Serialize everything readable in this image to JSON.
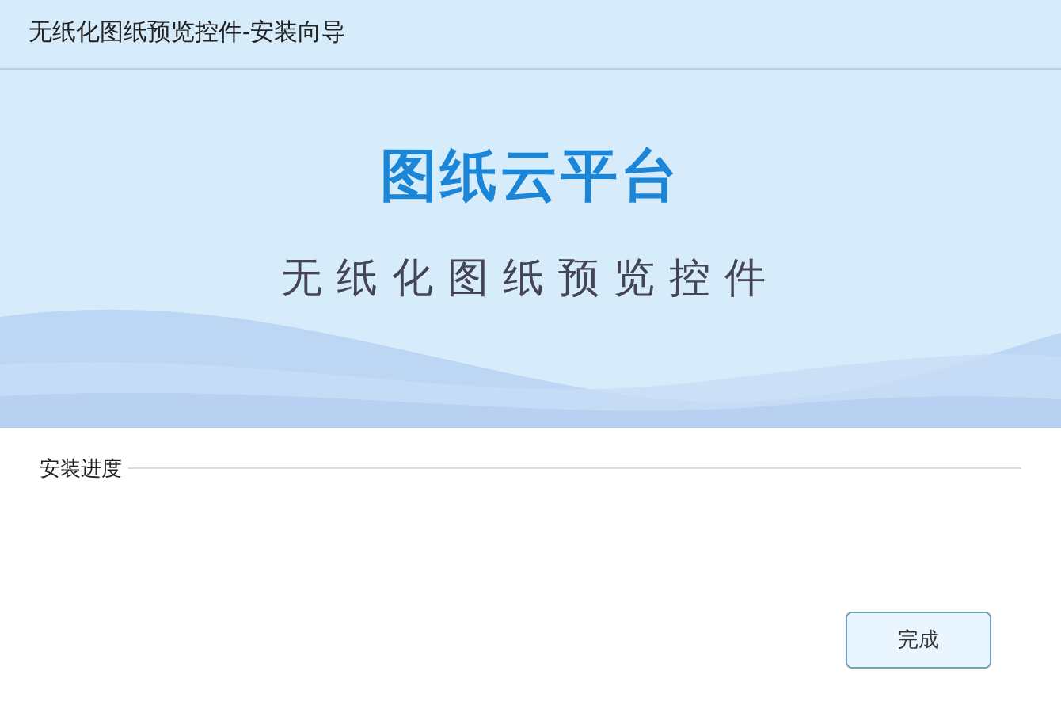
{
  "window": {
    "title": "无纸化图纸预览控件-安装向导"
  },
  "banner": {
    "title": "图纸云平台",
    "subtitle": "无纸化图纸预览控件"
  },
  "progress": {
    "label": "安装进度"
  },
  "buttons": [
    "完成"
  ]
}
